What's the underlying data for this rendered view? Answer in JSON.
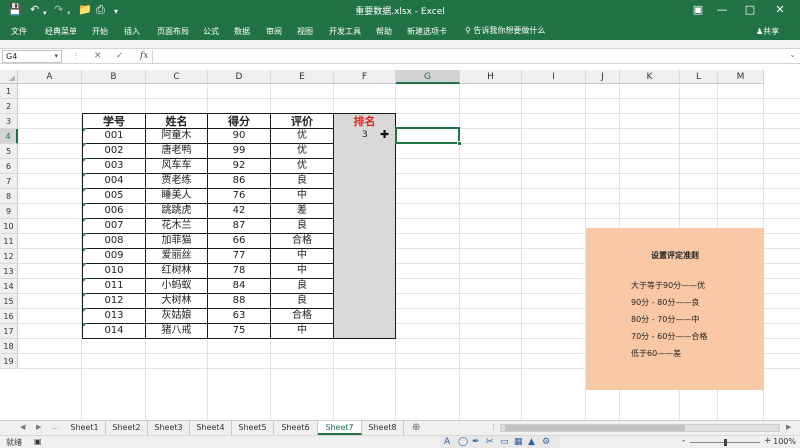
{
  "window": {
    "title": "重要数据.xlsx  -  Excel",
    "quick_access": [
      "save-icon",
      "undo-icon",
      "redo-icon",
      "folder-icon",
      "print-icon",
      "more-icon"
    ],
    "controls": [
      "ribbon-display-icon",
      "minimize-icon",
      "restore-icon",
      "close-icon"
    ]
  },
  "ribbon": {
    "tabs": [
      "文件",
      "经典菜单",
      "开始",
      "插入",
      "页面布局",
      "公式",
      "数据",
      "审阅",
      "视图",
      "开发工具",
      "帮助",
      "新建选项卡"
    ],
    "search_placeholder": "告诉我你想要做什么",
    "share_label": "共享"
  },
  "formula_bar": {
    "name_box": "G4",
    "fx": "fx",
    "value": ""
  },
  "columns": [
    "A",
    "B",
    "C",
    "D",
    "E",
    "F",
    "G",
    "H",
    "I",
    "J",
    "K",
    "L",
    "M"
  ],
  "rows": [
    "1",
    "2",
    "3",
    "4",
    "5",
    "6",
    "7",
    "8",
    "9",
    "10",
    "11",
    "12",
    "13",
    "14",
    "15",
    "16",
    "17",
    "18",
    "19"
  ],
  "table": {
    "headers": [
      "学号",
      "姓名",
      "得分",
      "评价",
      "排名"
    ],
    "header_accent_color": "#e8271c",
    "rank_fill_color": "#d9d9d9",
    "rows": [
      [
        "001",
        "阿童木",
        "90",
        "优",
        "3"
      ],
      [
        "002",
        "唐老鸭",
        "99",
        "优",
        ""
      ],
      [
        "003",
        "风车车",
        "92",
        "优",
        ""
      ],
      [
        "004",
        "贾老练",
        "86",
        "良",
        ""
      ],
      [
        "005",
        "睡美人",
        "76",
        "中",
        ""
      ],
      [
        "006",
        "跳跳虎",
        "42",
        "差",
        ""
      ],
      [
        "007",
        "花木兰",
        "87",
        "良",
        ""
      ],
      [
        "008",
        "加菲猫",
        "66",
        "合格",
        ""
      ],
      [
        "009",
        "爱丽丝",
        "77",
        "中",
        ""
      ],
      [
        "010",
        "红树林",
        "78",
        "中",
        ""
      ],
      [
        "011",
        "小蚂蚁",
        "84",
        "良",
        ""
      ],
      [
        "012",
        "大树林",
        "88",
        "良",
        ""
      ],
      [
        "013",
        "灰姑娘",
        "63",
        "合格",
        ""
      ],
      [
        "014",
        "猪八戒",
        "75",
        "中",
        ""
      ]
    ]
  },
  "info_box": {
    "title": "设置评定准则",
    "background_color": "#fac8a4",
    "rules": [
      "大于等于90分——优",
      "90分 - 80分——良",
      "80分 - 70分——中",
      "70分 - 60分——合格",
      "低于60——差"
    ]
  },
  "sheets": {
    "tabs": [
      "Sheet1",
      "Sheet2",
      "Sheet3",
      "Sheet4",
      "Sheet5",
      "Sheet6",
      "Sheet7",
      "Sheet8"
    ],
    "active": "Sheet7"
  },
  "status": {
    "ready": "就绪",
    "zoom": "100%",
    "zoom_minus": "-",
    "zoom_plus": "+"
  },
  "accent_color": "#217346"
}
